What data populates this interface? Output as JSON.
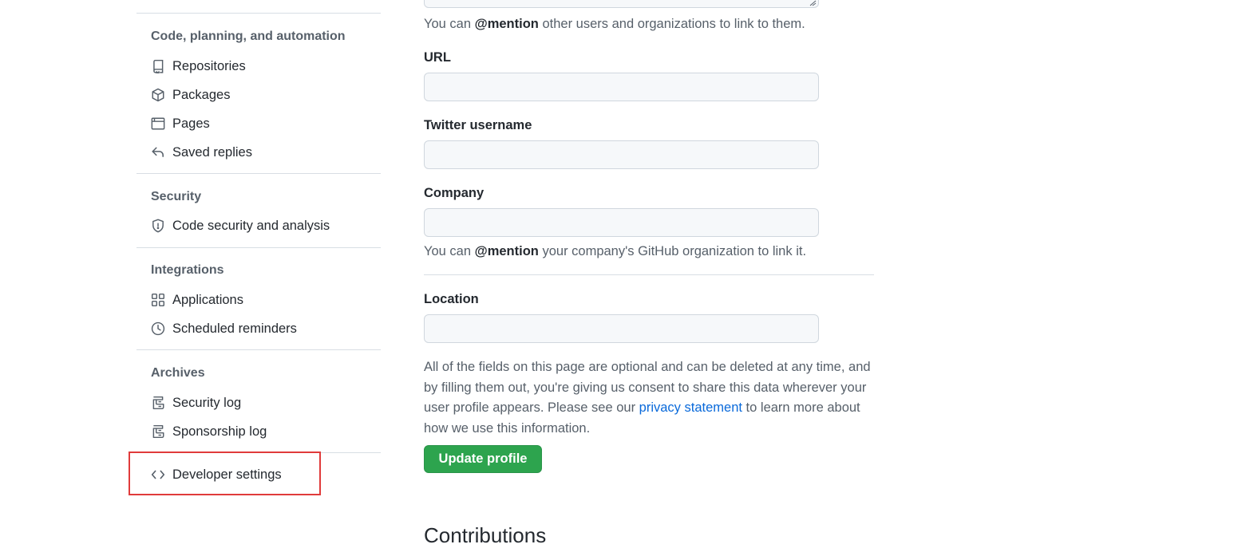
{
  "sidebar": {
    "sections": {
      "code": {
        "heading": "Code, planning, and automation",
        "items": [
          {
            "label": "Repositories",
            "icon": "repo-icon"
          },
          {
            "label": "Packages",
            "icon": "package-icon"
          },
          {
            "label": "Pages",
            "icon": "browser-icon"
          },
          {
            "label": "Saved replies",
            "icon": "reply-icon"
          }
        ]
      },
      "security": {
        "heading": "Security",
        "items": [
          {
            "label": "Code security and analysis",
            "icon": "shield-icon"
          }
        ]
      },
      "integrations": {
        "heading": "Integrations",
        "items": [
          {
            "label": "Applications",
            "icon": "apps-icon"
          },
          {
            "label": "Scheduled reminders",
            "icon": "clock-icon"
          }
        ]
      },
      "archives": {
        "heading": "Archives",
        "items": [
          {
            "label": "Security log",
            "icon": "log-icon"
          },
          {
            "label": "Sponsorship log",
            "icon": "log-icon"
          }
        ]
      }
    },
    "developer_settings": {
      "label": "Developer settings",
      "icon": "code-icon"
    },
    "highlight_color": "#e03b3b"
  },
  "form": {
    "bio_note": {
      "prefix": "You can ",
      "mention": "@mention",
      "suffix": " other users and organizations to link to them."
    },
    "url": {
      "label": "URL",
      "value": ""
    },
    "twitter": {
      "label": "Twitter username",
      "value": ""
    },
    "company": {
      "label": "Company",
      "value": ""
    },
    "company_note": {
      "prefix": "You can ",
      "mention": "@mention",
      "suffix": " your company's GitHub organization to link it."
    },
    "location": {
      "label": "Location",
      "value": ""
    },
    "consent": {
      "text_before": "All of the fields on this page are optional and can be deleted at any time, and by filling them out, you're giving us consent to share this data wherever your user profile appears. Please see our ",
      "link": "privacy statement",
      "text_after": " to learn more about how we use this information."
    },
    "submit_label": "Update profile"
  },
  "contributions": {
    "title": "Contributions"
  },
  "colors": {
    "primary_button": "#2da44e",
    "link": "#0969da",
    "muted_text": "#57606a",
    "border": "#d0d7de"
  }
}
